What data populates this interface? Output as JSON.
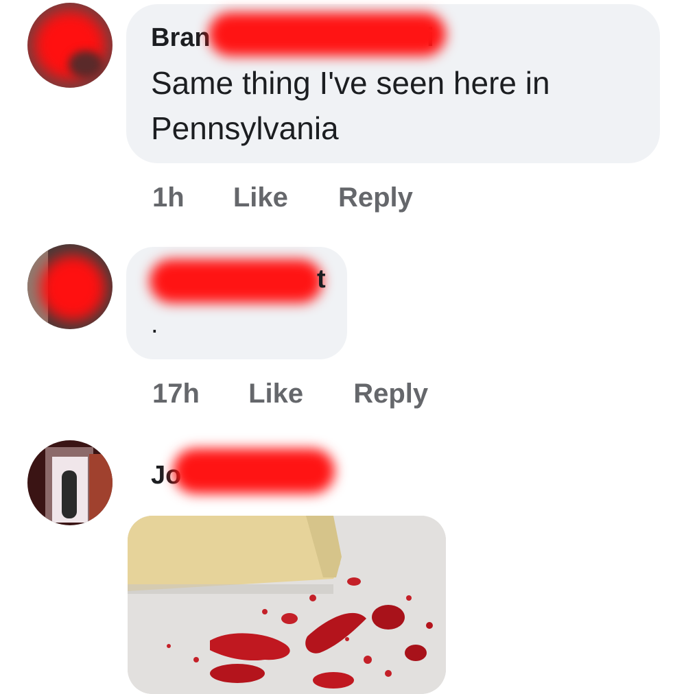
{
  "comments": [
    {
      "author_visible": "Bran",
      "author_tail": "i",
      "text_line1": "Same thing I've seen here in",
      "text_line2": "Pennsylvania",
      "time": "1h",
      "like": "Like",
      "reply": "Reply"
    },
    {
      "author_visible": "",
      "author_tail": "t",
      "text_line1": ".",
      "time": "17h",
      "like": "Like",
      "reply": "Reply"
    },
    {
      "author_visible": "Jo",
      "author_tail": ""
    }
  ],
  "colors": {
    "bubble": "#f0f2f5",
    "meta": "#65676b",
    "text": "#1c1e21",
    "redaction": "#ff1414"
  }
}
